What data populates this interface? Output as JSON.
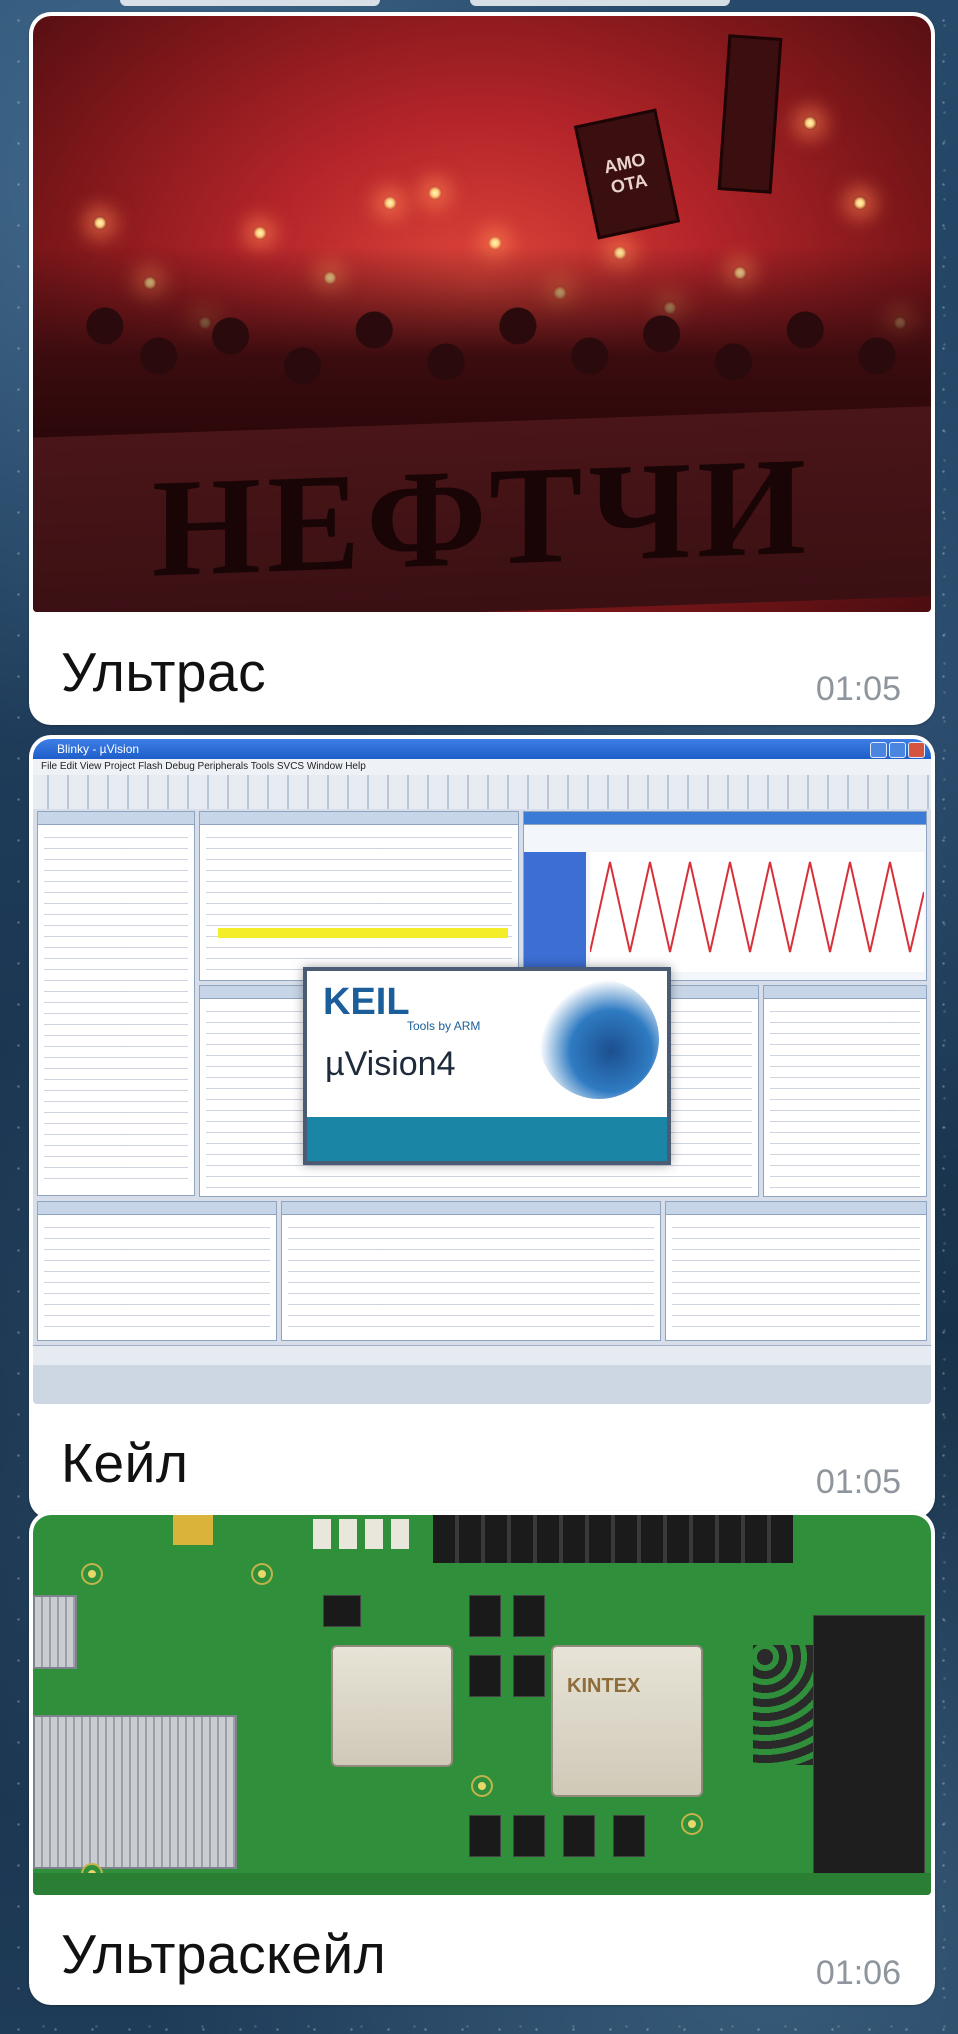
{
  "messages": [
    {
      "caption": "Ультрас",
      "time": "01:05",
      "image": {
        "kind": "photo-ultras",
        "banner_text": "НЕФТЧИ",
        "flag_text": "AMO OTA"
      }
    },
    {
      "caption": "Кейл",
      "time": "01:05",
      "image": {
        "kind": "screenshot-keil",
        "window_title": "Blinky - µVision",
        "splash_brand": "KEIL",
        "splash_product": "µVision4",
        "splash_sub": "Tools by ARM"
      }
    },
    {
      "caption": "Ультраскейл",
      "time": "01:06",
      "image": {
        "kind": "photo-fpga-board",
        "chip_label": "KINTEX"
      }
    }
  ],
  "colors": {
    "bubble": "#ffffff",
    "time": "#8e959c",
    "caption": "#111111",
    "wallpaper": "#1d3a57"
  }
}
